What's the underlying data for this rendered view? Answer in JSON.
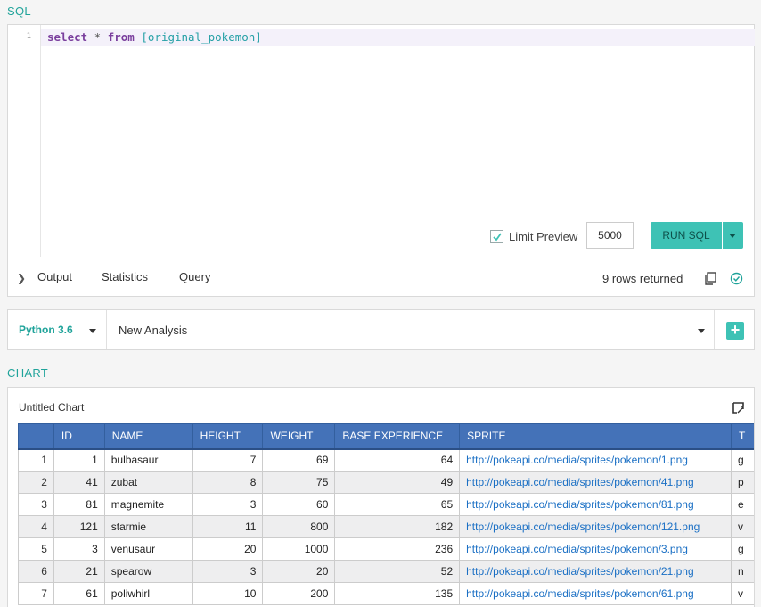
{
  "sql_section": {
    "label": "SQL",
    "line_number": "1",
    "query": {
      "kw1": "select",
      "star": " * ",
      "kw2": "from",
      "table": " [original_pokemon]"
    },
    "limit_preview_label": "Limit Preview",
    "limit_preview_checked": true,
    "limit_value": "5000",
    "run_label": "RUN SQL",
    "tabs": [
      "Output",
      "Statistics",
      "Query"
    ],
    "rows_returned": "9 rows returned"
  },
  "analysis_bar": {
    "kernel": "Python 3.6",
    "analysis_name": "New Analysis",
    "add_symbol": "+"
  },
  "chart_section": {
    "label": "CHART",
    "title": "Untitled Chart",
    "columns": [
      "",
      "ID",
      "NAME",
      "HEIGHT",
      "WEIGHT",
      "BASE EXPERIENCE",
      "SPRITE",
      "T"
    ],
    "rows": [
      {
        "idx": "1",
        "id": "1",
        "name": "bulbasaur",
        "height": "7",
        "weight": "69",
        "base_exp": "64",
        "sprite": "http://pokeapi.co/media/sprites/pokemon/1.png",
        "type": "g"
      },
      {
        "idx": "2",
        "id": "41",
        "name": "zubat",
        "height": "8",
        "weight": "75",
        "base_exp": "49",
        "sprite": "http://pokeapi.co/media/sprites/pokemon/41.png",
        "type": "p"
      },
      {
        "idx": "3",
        "id": "81",
        "name": "magnemite",
        "height": "3",
        "weight": "60",
        "base_exp": "65",
        "sprite": "http://pokeapi.co/media/sprites/pokemon/81.png",
        "type": "e"
      },
      {
        "idx": "4",
        "id": "121",
        "name": "starmie",
        "height": "11",
        "weight": "800",
        "base_exp": "182",
        "sprite": "http://pokeapi.co/media/sprites/pokemon/121.png",
        "type": "v"
      },
      {
        "idx": "5",
        "id": "3",
        "name": "venusaur",
        "height": "20",
        "weight": "1000",
        "base_exp": "236",
        "sprite": "http://pokeapi.co/media/sprites/pokemon/3.png",
        "type": "g"
      },
      {
        "idx": "6",
        "id": "21",
        "name": "spearow",
        "height": "3",
        "weight": "20",
        "base_exp": "52",
        "sprite": "http://pokeapi.co/media/sprites/pokemon/21.png",
        "type": "n"
      },
      {
        "idx": "7",
        "id": "61",
        "name": "poliwhirl",
        "height": "10",
        "weight": "200",
        "base_exp": "135",
        "sprite": "http://pokeapi.co/media/sprites/pokemon/61.png",
        "type": "v"
      }
    ]
  },
  "colors": {
    "accent": "#3ec2b5",
    "accent_text": "#1fa39a",
    "table_header": "#4472b8",
    "link": "#1a6fc4"
  }
}
